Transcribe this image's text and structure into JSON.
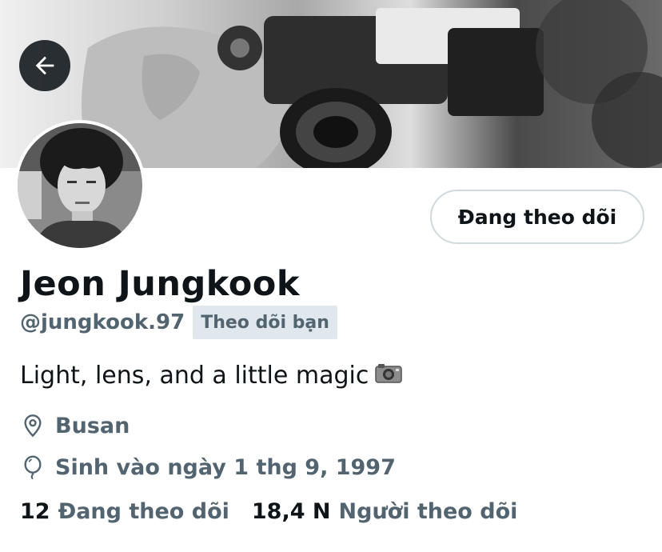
{
  "profile": {
    "display_name": "Jeon Jungkook",
    "handle": "@jungkook.97",
    "follows_you_badge": "Theo dõi bạn",
    "bio": "Light, lens, and a little magic",
    "location": "Busan",
    "birthday": "Sinh vào ngày 1 thg 9, 1997"
  },
  "actions": {
    "follow_button_label": "Đang theo dõi",
    "back_icon": "arrow-left-icon"
  },
  "stats": {
    "following_count": "12",
    "following_label": "Đang theo dõi",
    "followers_count": "18,4 N",
    "followers_label": "Người theo dõi"
  },
  "colors": {
    "text_primary": "#0f1419",
    "text_secondary": "#536471",
    "badge_bg": "#e1e8ed",
    "button_border": "#cfd9de"
  }
}
